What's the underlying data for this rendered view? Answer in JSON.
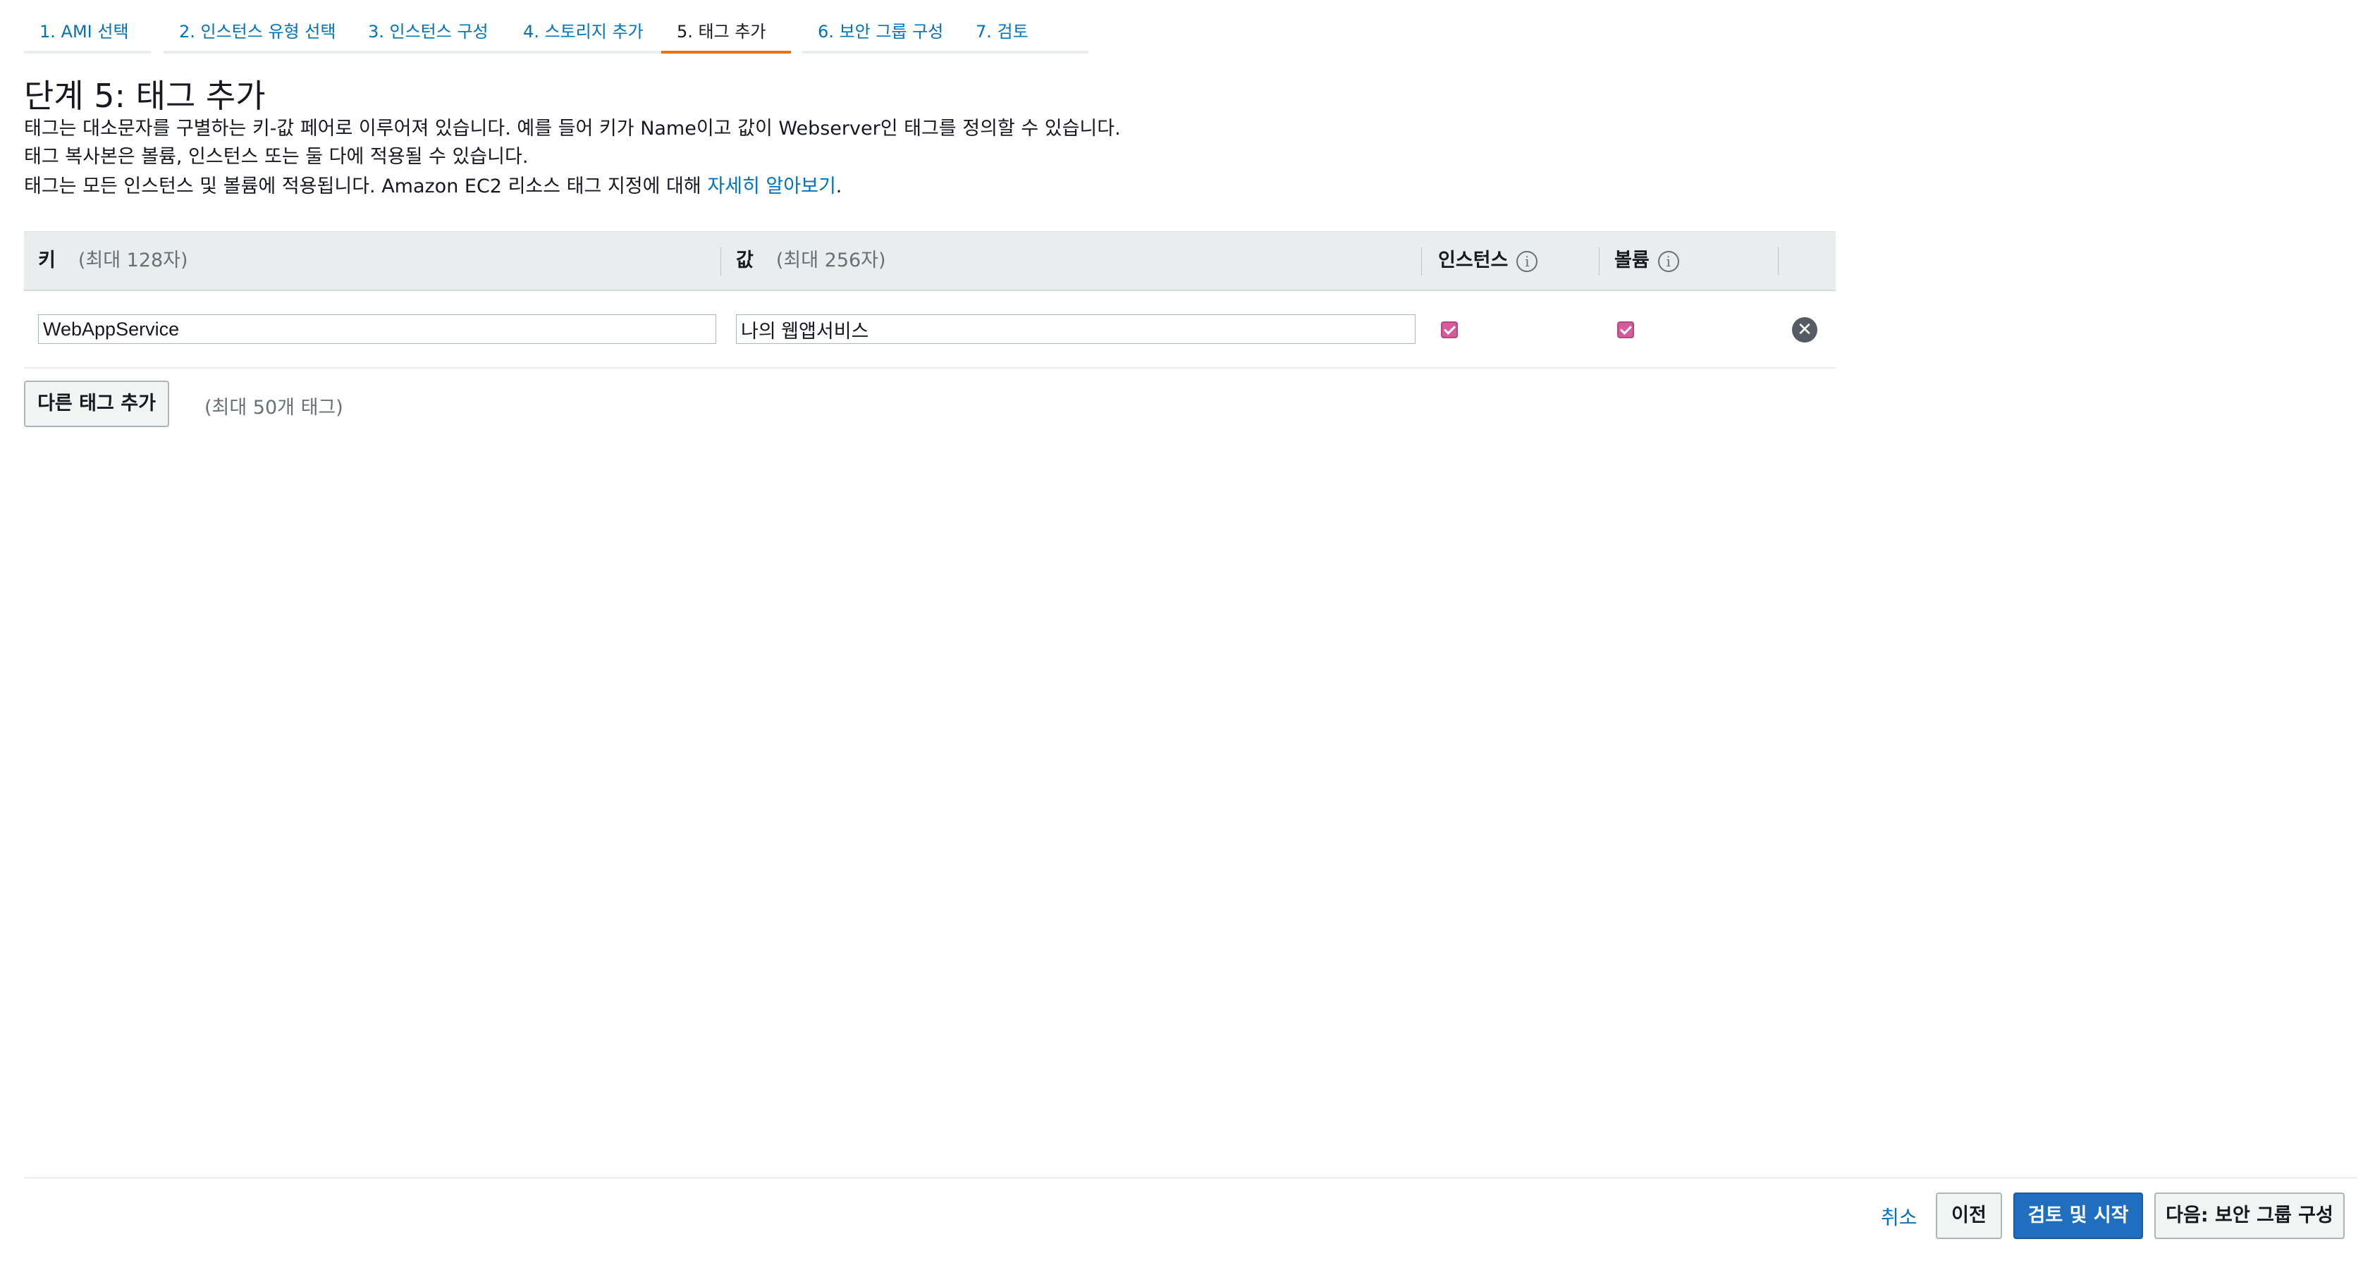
{
  "tabs": [
    {
      "label": "1. AMI 선택"
    },
    {
      "label": "2. 인스턴스 유형 선택"
    },
    {
      "label": "3. 인스턴스 구성"
    },
    {
      "label": "4. 스토리지 추가"
    },
    {
      "label": "5. 태그 추가",
      "active": true
    },
    {
      "label": "6. 보안 그룹 구성"
    },
    {
      "label": "7. 검토"
    }
  ],
  "page": {
    "title": "단계 5: 태그 추가",
    "desc_line1": "태그는 대소문자를 구별하는 키-값 페어로 이루어져 있습니다. 예를 들어 키가 Name이고 값이 Webserver인 태그를 정의할 수 있습니다.",
    "desc_line2": "태그 복사본은 볼륨, 인스턴스 또는 둘 다에 적용될 수 있습니다.",
    "desc_line3": "태그는 모든 인스턴스 및 볼륨에 적용됩니다. Amazon EC2 리소스 태그 지정에 대해",
    "learn_more": "자세히 알아보기",
    "period": "."
  },
  "table": {
    "headers": {
      "key": "키",
      "key_hint": "(최대 128자)",
      "value": "값",
      "value_hint": "(최대 256자)",
      "instances": "인스턴스",
      "volumes": "볼륨"
    },
    "rows": [
      {
        "key": "WebAppService",
        "value": "나의 웹앱서비스",
        "instances": true,
        "volumes": true
      }
    ]
  },
  "add_tag": {
    "label": "다른 태그 추가",
    "limit": "(최대 50개 태그)"
  },
  "footer": {
    "cancel": "취소",
    "previous": "이전",
    "review_launch": "검토 및 시작",
    "next": "다음: 보안 그룹 구성"
  },
  "icons": {
    "info": "info-icon",
    "remove": "remove-circle-icon",
    "checkbox": "checkbox-checked-icon"
  },
  "colors": {
    "link": "#0073bb",
    "active_tab_border": "#ec7211",
    "checkbox": "#d45b9c",
    "primary_button": "#1f6ebf"
  }
}
